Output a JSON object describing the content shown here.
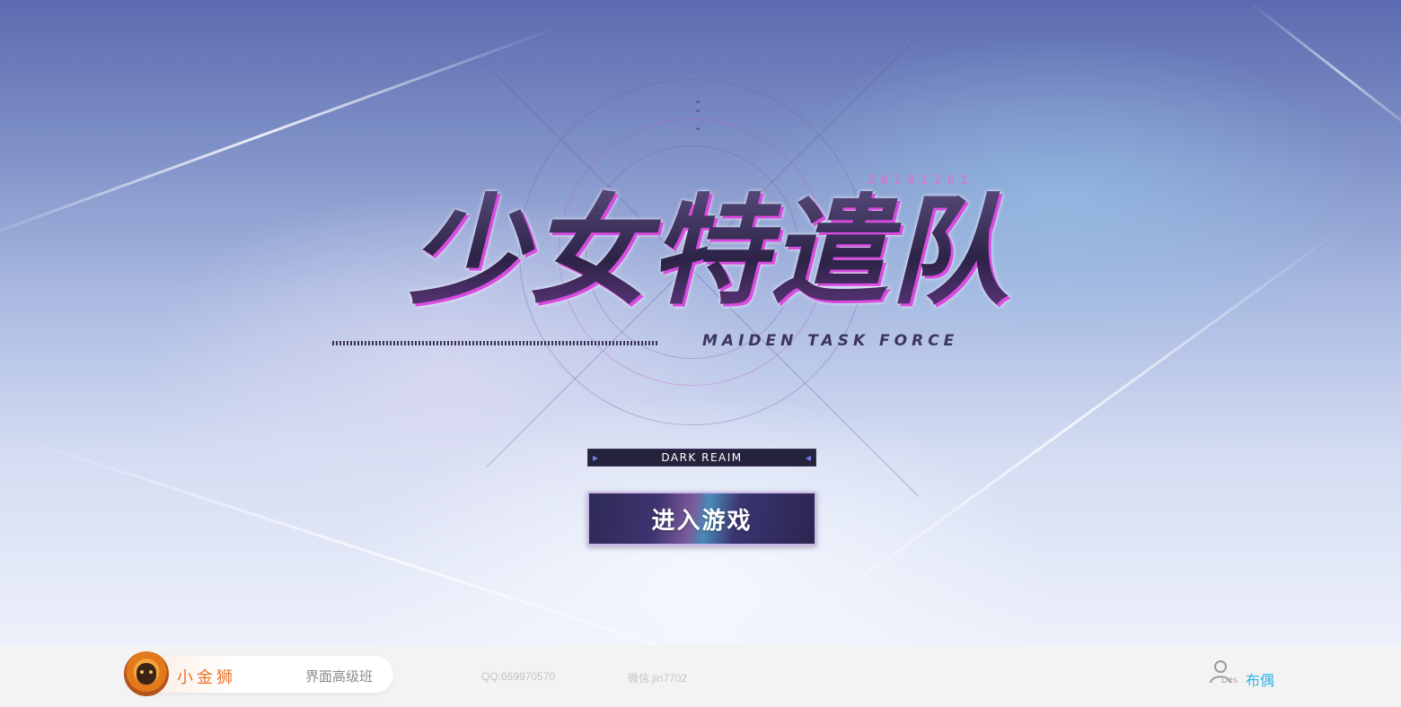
{
  "logo": {
    "title": "少女特遣队",
    "date": "20201201",
    "subtitle": "MAIDEN TASK FORCE"
  },
  "server": {
    "name": "DARK REAIM"
  },
  "enter_button": {
    "label": "进入游戏"
  },
  "footer": {
    "brand_name": "小金狮",
    "course": "界面高级班",
    "qq": "QQ:669970570",
    "wechat": "微信:jin7702",
    "des_label": "Des",
    "author": "布偶"
  },
  "colors": {
    "accent_pink": "#d84ce0",
    "brand_orange": "#e8742a",
    "author_blue": "#2fb3e8"
  }
}
